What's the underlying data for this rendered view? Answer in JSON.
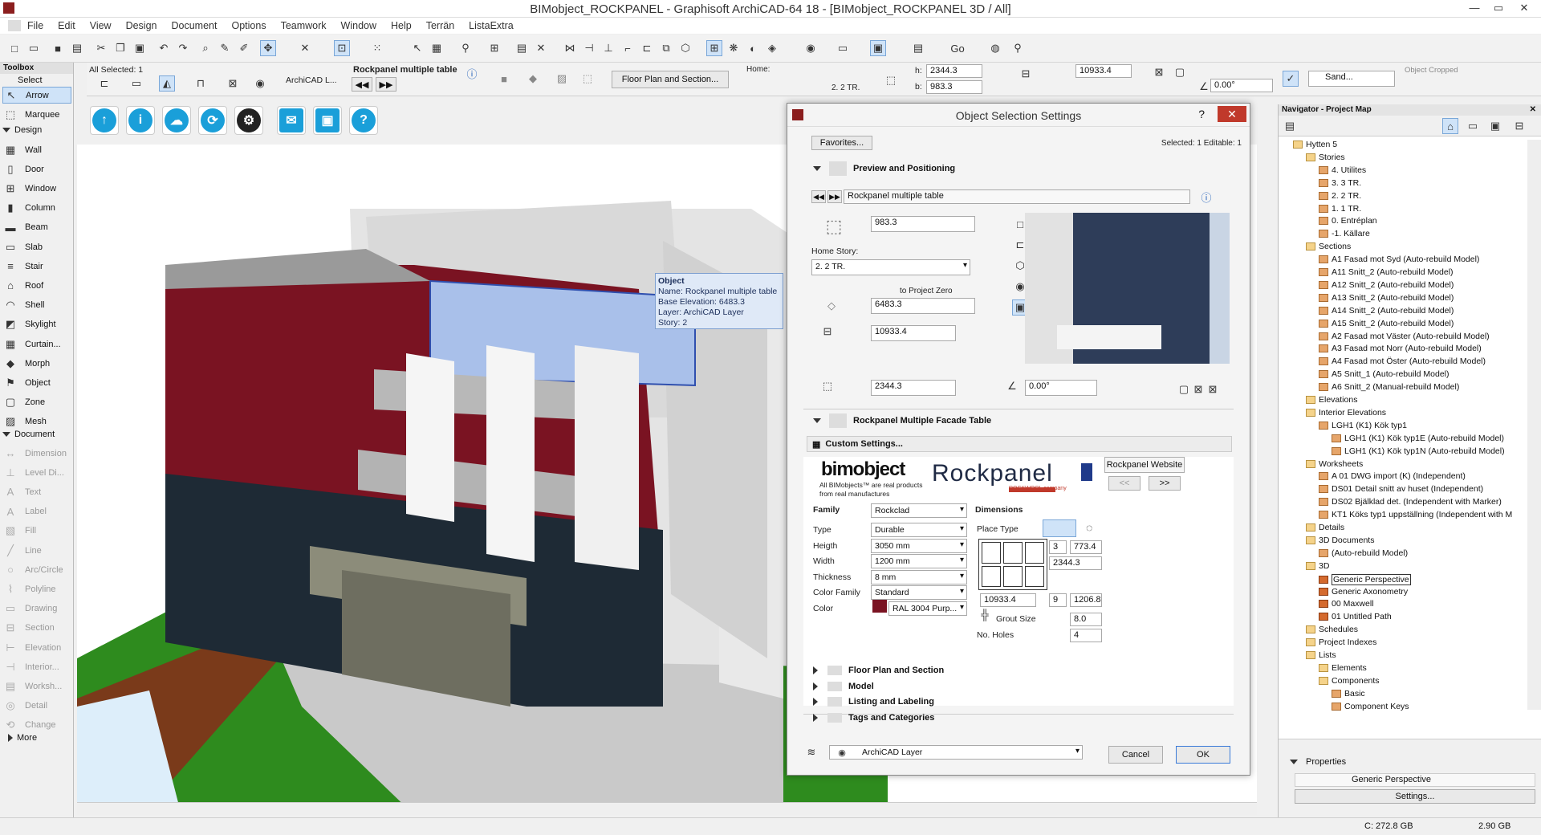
{
  "window": {
    "title": "BIMobject_ROCKPANEL - Graphisoft ArchiCAD-64 18 - [BIMobject_ROCKPANEL 3D / All]",
    "controls": [
      "—",
      "▭",
      "✕"
    ]
  },
  "menu": [
    "File",
    "Edit",
    "View",
    "Design",
    "Document",
    "Options",
    "Teamwork",
    "Window",
    "Help",
    "Terrän",
    "ListaExtra"
  ],
  "infobox": {
    "all_selected": "All Selected: 1",
    "layer": "ArchiCAD L...",
    "object_name": "Rockpanel multiple table",
    "floor_plan_button": "Floor Plan and Section...",
    "home_label": "Home:",
    "home_value": "2. 2 TR.",
    "h_label": "h:",
    "h_value": "2344.3",
    "b_label": "b:",
    "b_value": "983.3",
    "width_value": "10933.4",
    "angle_value": "0.00°",
    "surface": "Sand...",
    "object_cropped": "Object Cropped"
  },
  "toolbox": {
    "title": "Toolbox",
    "select_label": "Select",
    "select_tools": [
      "Arrow",
      "Marquee"
    ],
    "design_label": "Design",
    "design_tools": [
      "Wall",
      "Door",
      "Window",
      "Column",
      "Beam",
      "Slab",
      "Stair",
      "Roof",
      "Shell",
      "Skylight",
      "Curtain...",
      "Morph",
      "Object",
      "Zone",
      "Mesh"
    ],
    "document_label": "Document",
    "document_tools": [
      "Dimension",
      "Level Di...",
      "Text",
      "Label",
      "Fill",
      "Line",
      "Arc/Circle",
      "Polyline",
      "Drawing",
      "Section",
      "Elevation",
      "Interior...",
      "Worksh...",
      "Detail",
      "Change"
    ],
    "more_label": "More"
  },
  "tooltip": {
    "title": "Object",
    "lines": [
      "Name: Rockpanel multiple table",
      "Base Elevation: 6483.3",
      "Layer: ArchiCAD Layer",
      "Story: 2"
    ]
  },
  "dialog": {
    "title": "Object Selection Settings",
    "help": "?",
    "favorites": "Favorites...",
    "selected_info": "Selected: 1 Editable: 1",
    "preview_section": "Preview and Positioning",
    "library_part": "Rockpanel multiple table",
    "height_value": "983.3",
    "home_story_label": "Home Story:",
    "home_story_value": "2. 2 TR.",
    "to_project_zero": "to Project Zero",
    "elevation_value": "6483.3",
    "width_value": "10933.4",
    "depth_value": "2344.3",
    "angle_value": "0.00°",
    "params_section": "Rockpanel Multiple Facade Table",
    "custom_settings": "Custom Settings...",
    "bimobject_logo": "bimobject",
    "bimobject_tagline": "All BIMobjects™ are real products from real manufactures",
    "rockpanel_logo": "Rockpanel",
    "rockwool": "ROCKWOOL company",
    "website_btn": "Rockpanel Website",
    "prev_btn": "<<",
    "next_btn": ">>",
    "family_header": "Family",
    "family_value": "Rockclad",
    "params": [
      {
        "label": "Type",
        "value": "Durable"
      },
      {
        "label": "Heigth",
        "value": "3050 mm"
      },
      {
        "label": "Width",
        "value": "1200 mm"
      },
      {
        "label": "Thickness",
        "value": "8 mm"
      },
      {
        "label": "Color Family",
        "value": "Standard"
      },
      {
        "label": "Color",
        "value": "RAL 3004 Purp..."
      }
    ],
    "color_swatch": "#7a1322",
    "dimensions_header": "Dimensions",
    "place_type_label": "Place Type",
    "dim_count_1": "3",
    "dim_value_1": "773.4",
    "dim_total_1": "2344.3",
    "dim_total_2": "10933.4",
    "dim_count_2": "9",
    "dim_value_2": "1206.8",
    "grout_label": "Grout Size",
    "grout_value": "8.0",
    "holes_label": "No. Holes",
    "holes_value": "4",
    "collapsed_sections": [
      "Floor Plan and Section",
      "Model",
      "Listing and Labeling",
      "Tags and Categories"
    ],
    "layer_value": "ArchiCAD Layer",
    "cancel": "Cancel",
    "ok": "OK"
  },
  "navigator": {
    "title": "Navigator - Project Map",
    "tree": [
      {
        "d": 0,
        "t": "Hytten 5",
        "k": "fo"
      },
      {
        "d": 1,
        "t": "Stories",
        "k": "fo"
      },
      {
        "d": 2,
        "t": "4. Utilites",
        "k": "fi"
      },
      {
        "d": 2,
        "t": "3. 3 TR.",
        "k": "fi"
      },
      {
        "d": 2,
        "t": "2. 2 TR.",
        "k": "fi"
      },
      {
        "d": 2,
        "t": "1. 1 TR.",
        "k": "fi"
      },
      {
        "d": 2,
        "t": "0. Entréplan",
        "k": "fi"
      },
      {
        "d": 2,
        "t": "-1. Källare",
        "k": "fi"
      },
      {
        "d": 1,
        "t": "Sections",
        "k": "fo"
      },
      {
        "d": 2,
        "t": "A1 Fasad mot Syd (Auto-rebuild Model)",
        "k": "fi"
      },
      {
        "d": 2,
        "t": "A11 Snitt_2 (Auto-rebuild Model)",
        "k": "fi"
      },
      {
        "d": 2,
        "t": "A12 Snitt_2 (Auto-rebuild Model)",
        "k": "fi"
      },
      {
        "d": 2,
        "t": "A13 Snitt_2 (Auto-rebuild Model)",
        "k": "fi"
      },
      {
        "d": 2,
        "t": "A14 Snitt_2 (Auto-rebuild Model)",
        "k": "fi"
      },
      {
        "d": 2,
        "t": "A15 Snitt_2 (Auto-rebuild Model)",
        "k": "fi"
      },
      {
        "d": 2,
        "t": "A2 Fasad mot Väster (Auto-rebuild Model)",
        "k": "fi"
      },
      {
        "d": 2,
        "t": "A3 Fasad mot Norr (Auto-rebuild Model)",
        "k": "fi"
      },
      {
        "d": 2,
        "t": "A4 Fasad mot Öster (Auto-rebuild Model)",
        "k": "fi"
      },
      {
        "d": 2,
        "t": "A5 Snitt_1 (Auto-rebuild Model)",
        "k": "fi"
      },
      {
        "d": 2,
        "t": "A6 Snitt_2 (Manual-rebuild Model)",
        "k": "fi"
      },
      {
        "d": 1,
        "t": "Elevations",
        "k": "fo"
      },
      {
        "d": 1,
        "t": "Interior Elevations",
        "k": "fo"
      },
      {
        "d": 2,
        "t": "LGH1 (K1) Kök typ1",
        "k": "fi"
      },
      {
        "d": 3,
        "t": "LGH1 (K1) Kök typ1E (Auto-rebuild Model)",
        "k": "fi"
      },
      {
        "d": 3,
        "t": "LGH1 (K1) Kök typ1N (Auto-rebuild Model)",
        "k": "fi"
      },
      {
        "d": 1,
        "t": "Worksheets",
        "k": "fo"
      },
      {
        "d": 2,
        "t": "A 01 DWG import (K) (Independent)",
        "k": "fi"
      },
      {
        "d": 2,
        "t": "DS01 Detail snitt av huset (Independent)",
        "k": "fi"
      },
      {
        "d": 2,
        "t": "DS02 Bjälklad det. (Independent with Marker)",
        "k": "fi"
      },
      {
        "d": 2,
        "t": "KT1 Köks typ1 uppställning (Independent with M",
        "k": "fi"
      },
      {
        "d": 1,
        "t": "Details",
        "k": "fo"
      },
      {
        "d": 1,
        "t": "3D Documents",
        "k": "fo"
      },
      {
        "d": 2,
        "t": "(Auto-rebuild Model)",
        "k": "fi"
      },
      {
        "d": 1,
        "t": "3D",
        "k": "fo"
      },
      {
        "d": 2,
        "t": "Generic Perspective",
        "k": "vi",
        "sel": true
      },
      {
        "d": 2,
        "t": "Generic Axonometry",
        "k": "vi"
      },
      {
        "d": 2,
        "t": "00 Maxwell",
        "k": "vi"
      },
      {
        "d": 2,
        "t": "01 Untitled Path",
        "k": "vi"
      },
      {
        "d": 1,
        "t": "Schedules",
        "k": "fo"
      },
      {
        "d": 1,
        "t": "Project Indexes",
        "k": "fo"
      },
      {
        "d": 1,
        "t": "Lists",
        "k": "fo"
      },
      {
        "d": 2,
        "t": "Elements",
        "k": "fo"
      },
      {
        "d": 2,
        "t": "Components",
        "k": "fo"
      },
      {
        "d": 3,
        "t": "Basic",
        "k": "fi"
      },
      {
        "d": 3,
        "t": "Component Keys",
        "k": "fi"
      }
    ],
    "properties_label": "Properties",
    "properties_value": "Generic Perspective",
    "settings_btn": "Settings..."
  },
  "status": {
    "disk": "C: 272.8 GB",
    "ram": "2.90 GB"
  },
  "colors": {
    "accent": "#1a9fd9",
    "brick": "#7a1322",
    "dark_brick": "#1e2a35",
    "grass": "#2e8b1e",
    "close": "#c0392b"
  }
}
